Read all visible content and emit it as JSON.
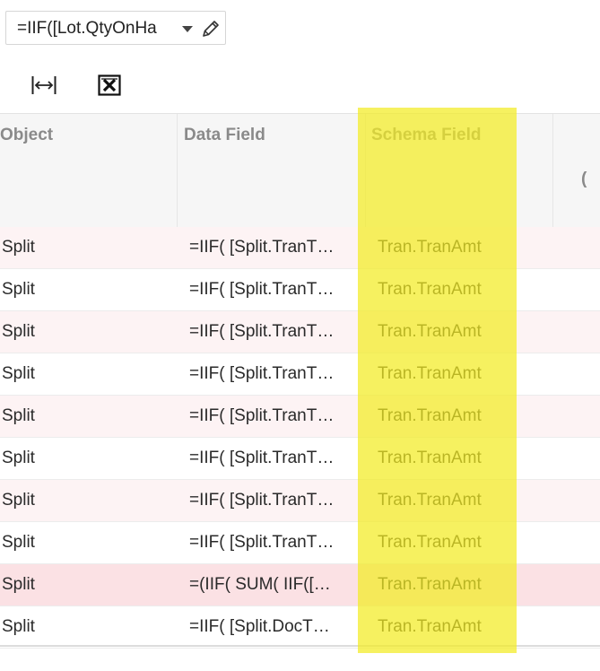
{
  "toolbar": {
    "formula_value": "=IIF([Lot.QtyOnHa",
    "fit_icon": "fit-columns-icon",
    "excel_icon": "export-excel-icon"
  },
  "grid": {
    "columns": [
      "Object",
      "Data Field",
      "Schema Field",
      "Wi\n("
    ],
    "rows": [
      {
        "object": "Split",
        "data_field": "=IIF( [Split.TranT…",
        "schema_field": "Tran.TranAmt",
        "style": "alt"
      },
      {
        "object": "Split",
        "data_field": "=IIF( [Split.TranT…",
        "schema_field": "Tran.TranAmt",
        "style": "plain"
      },
      {
        "object": "Split",
        "data_field": "=IIF( [Split.TranT…",
        "schema_field": "Tran.TranAmt",
        "style": "alt"
      },
      {
        "object": "Split",
        "data_field": "=IIF( [Split.TranT…",
        "schema_field": "Tran.TranAmt",
        "style": "plain"
      },
      {
        "object": "Split",
        "data_field": "=IIF( [Split.TranT…",
        "schema_field": "Tran.TranAmt",
        "style": "alt"
      },
      {
        "object": "Split",
        "data_field": "=IIF( [Split.TranT…",
        "schema_field": "Tran.TranAmt",
        "style": "plain"
      },
      {
        "object": "Split",
        "data_field": "=IIF( [Split.TranT…",
        "schema_field": "Tran.TranAmt",
        "style": "alt"
      },
      {
        "object": "Split",
        "data_field": "=IIF( [Split.TranT…",
        "schema_field": "Tran.TranAmt",
        "style": "plain"
      },
      {
        "object": "Split",
        "data_field": "=(IIF( SUM( IIF([…",
        "schema_field": "Tran.TranAmt",
        "style": "sel"
      },
      {
        "object": "Split",
        "data_field": "=IIF( [Split.DocT…",
        "schema_field": "Tran.TranAmt",
        "style": "plain"
      }
    ]
  },
  "colors": {
    "highlight": "#f2ec22",
    "alt_row": "#fdf3f4",
    "selected_row": "#fbe1e4",
    "header_text": "#8a8a8a"
  }
}
